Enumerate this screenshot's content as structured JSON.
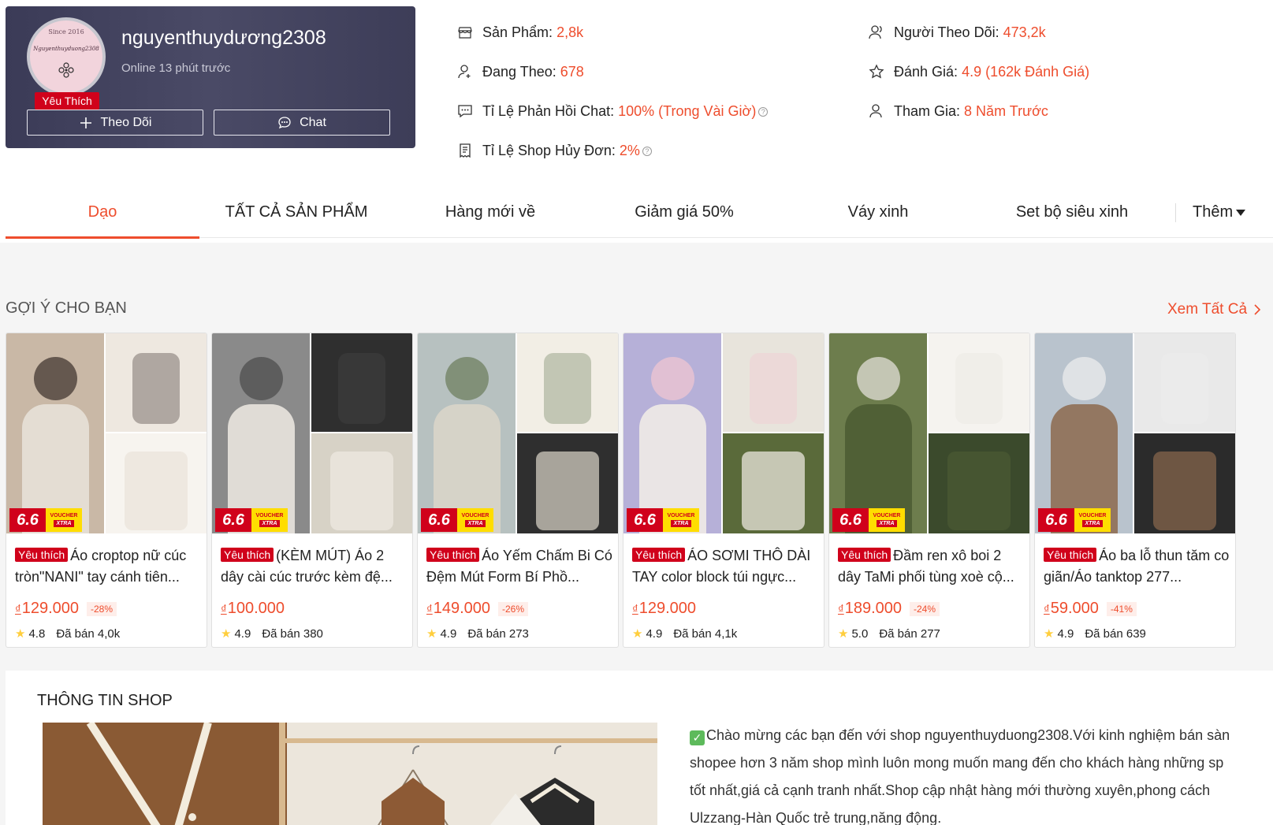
{
  "shop": {
    "name": "nguyenthuydương2308",
    "online": "Online 13 phút trước",
    "badge": "Yêu Thích",
    "avatar_text_since": "Since 2016",
    "avatar_text_name": "Nguyenthuyduong2308",
    "follow_label": "Theo Dõi",
    "chat_label": "Chat"
  },
  "stats": {
    "products_label": "Sản Phẩm:",
    "products_value": "2,8k",
    "following_label": "Đang Theo:",
    "following_value": "678",
    "chat_rate_label": "Tỉ Lệ Phản Hồi Chat:",
    "chat_rate_value": "100% (Trong Vài Giờ)",
    "cancel_rate_label": "Tỉ Lệ Shop Hủy Đơn:",
    "cancel_rate_value": "2%",
    "followers_label": "Người Theo Dõi:",
    "followers_value": "473,2k",
    "rating_label": "Đánh Giá:",
    "rating_value": "4.9 (162k Đánh Giá)",
    "joined_label": "Tham Gia:",
    "joined_value": "8 Năm Trước"
  },
  "tabs": [
    "Dạo",
    "TẤT CẢ SẢN PHẨM",
    "Hàng mới về",
    "Giảm giá 50%",
    "Váy xinh",
    "Set bộ siêu xinh"
  ],
  "tab_more": "Thêm",
  "suggest": {
    "title": "GỢI Ý CHO BẠN",
    "see_all": "Xem Tất Cả",
    "promo_66": "6.6",
    "promo_voucher": "VOUCHER",
    "promo_xtra": "XTRA",
    "fav_tag": "Yêu thích",
    "currency": "₫",
    "sold_prefix": "Đã bán",
    "products": [
      {
        "title": "Áo croptop nữ cúc tròn\"NANI\" tay cánh tiên...",
        "price": "129.000",
        "discount": "-28%",
        "rating": "4.8",
        "sold": "4,0k"
      },
      {
        "title": "(KÈM MÚT) Áo 2 dây cài cúc trước kèm đệ...",
        "price": "100.000",
        "discount": "",
        "rating": "4.9",
        "sold": "380"
      },
      {
        "title": "Áo Yếm Chấm Bi Có Đệm Mút Form Bí Phồ...",
        "price": "149.000",
        "discount": "-26%",
        "rating": "4.9",
        "sold": "273"
      },
      {
        "title": "ÁO SƠMI THÔ DÀI TAY color block túi ngực...",
        "price": "129.000",
        "discount": "",
        "rating": "4.9",
        "sold": "4,1k"
      },
      {
        "title": "Đầm ren xô boi 2 dây TaMi phối tùng xoè cộ...",
        "price": "189.000",
        "discount": "-24%",
        "rating": "5.0",
        "sold": "277"
      },
      {
        "title": "Áo ba lỗ thun tăm co giãn/Áo tanktop 277...",
        "price": "59.000",
        "discount": "-41%",
        "rating": "4.9",
        "sold": "639"
      }
    ]
  },
  "info": {
    "title": "THÔNG TIN SHOP",
    "text": "Chào mừng các bạn đến với shop nguyenthuyduong2308.Với kinh nghiệm bán sàn shopee hơn 3 năm shop mình luôn mong muốn mang đến cho khách hàng những sp tốt nhất,giá cả cạnh tranh nhất.Shop cập nhật hàng mới thường xuyên,phong cách Ulzzang-Hàn Quốc trẻ trung,năng động."
  },
  "colors": {
    "accent": "#ee4d2d",
    "fav_red": "#d0011b",
    "header_bg": "#3b3b57"
  }
}
